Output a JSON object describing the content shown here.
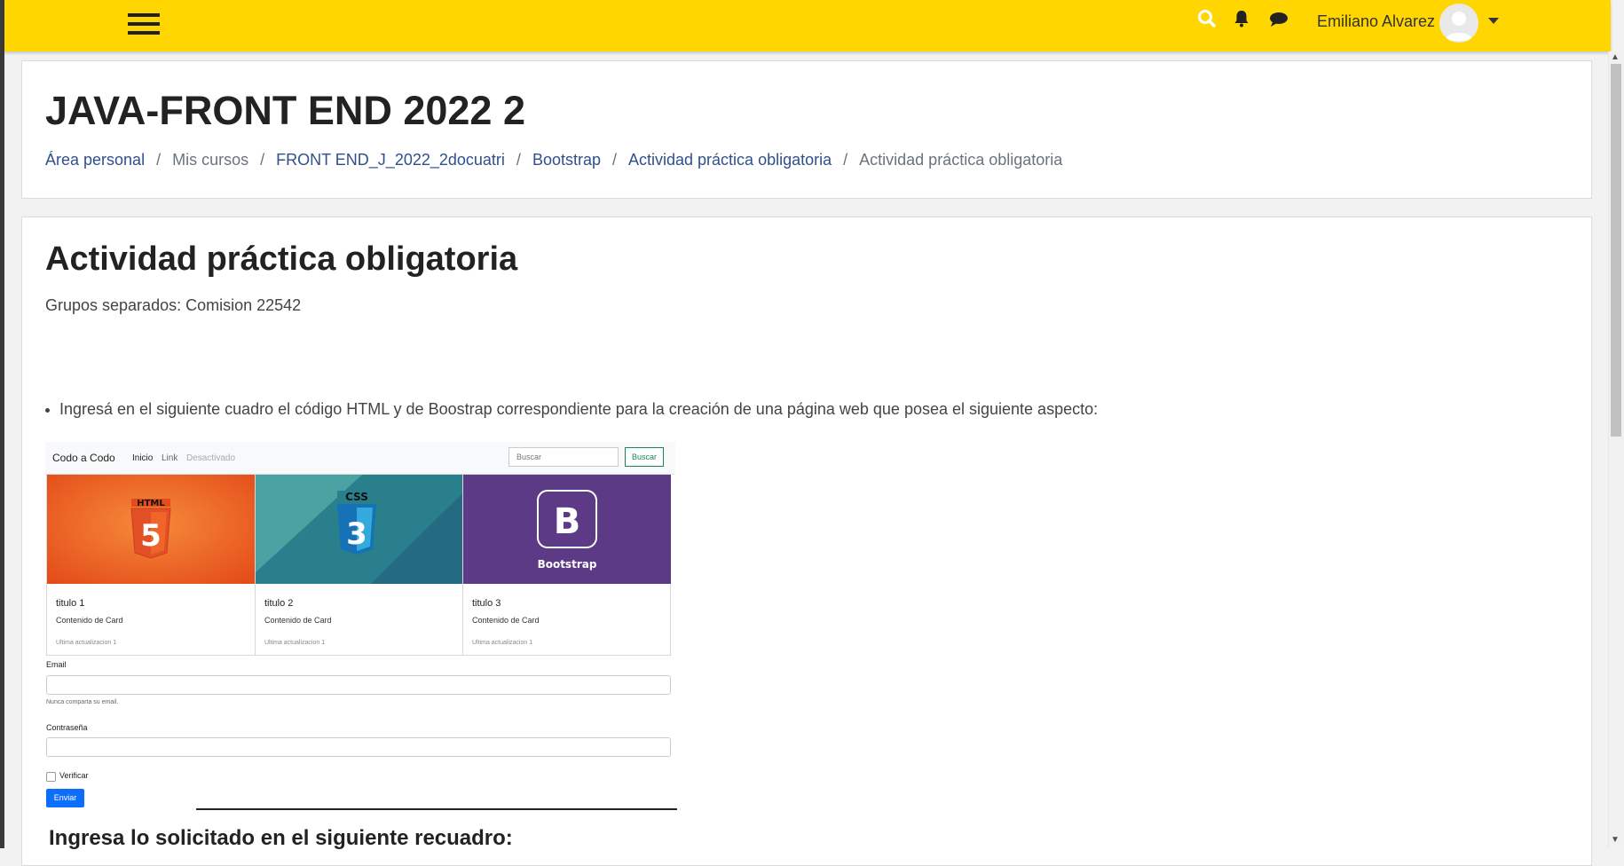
{
  "topbar": {
    "user_name": "Emiliano Alvarez",
    "colors": {
      "bar": "#ffd600",
      "link": "#2f4f8f"
    },
    "icons": [
      "menu-icon",
      "search-icon",
      "bell-icon",
      "chat-icon",
      "avatar",
      "caret-down-icon"
    ]
  },
  "header": {
    "course_title": "JAVA-FRONT END 2022 2",
    "breadcrumb": [
      {
        "label": "Área personal",
        "link": true
      },
      {
        "label": "Mis cursos",
        "link": false
      },
      {
        "label": "FRONT END_J_2022_2docuatri",
        "link": true
      },
      {
        "label": "Bootstrap",
        "link": true
      },
      {
        "label": "Actividad práctica obligatoria",
        "link": true
      },
      {
        "label": "Actividad práctica obligatoria",
        "link": false
      }
    ]
  },
  "content": {
    "activity_title": "Actividad práctica obligatoria",
    "group_mode": "Grupos separados: Comision 22542",
    "instruction": "Ingresá en el siguiente cuadro el código HTML y de Boostrap correspondiente para la creación de una página web que posea el siguiente aspecto:",
    "next_heading": "Ingresa lo solicitado en el siguiente recuadro:"
  },
  "preview": {
    "brand": "Codo a Codo",
    "nav_links": [
      "Inicio",
      "Link",
      "Desactivado"
    ],
    "search_placeholder": "Buscar",
    "search_button": "Buscar",
    "cards": [
      {
        "image_text": "HTML",
        "image_glyph": "5",
        "title": "titulo 1",
        "text": "Contenido de Card",
        "footer": "Ultima actualizacion 1"
      },
      {
        "image_text": "CSS",
        "image_glyph": "3",
        "title": "titulo 2",
        "text": "Contenido de Card",
        "footer": "Ultima actualizacion 1"
      },
      {
        "image_text": "Bootstrap",
        "image_glyph": "B",
        "title": "titulo 3",
        "text": "Contenido de Card",
        "footer": "Ultima actualizacion 1"
      }
    ],
    "email_label": "Email",
    "email_help": "Nunca comparta su email.",
    "password_label": "Contraseña",
    "checkbox_label": "Verificar",
    "submit_label": "Enviar"
  }
}
